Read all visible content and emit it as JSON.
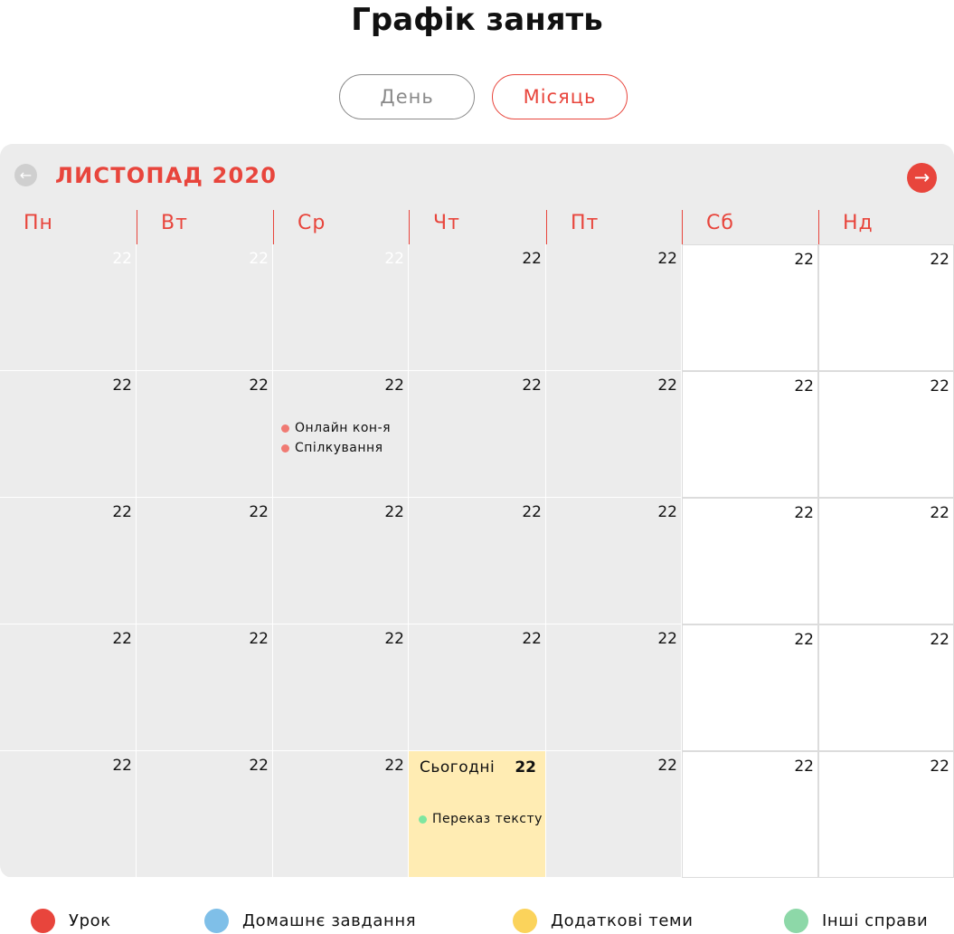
{
  "title": "Графік занять",
  "view_switch": {
    "day_label": "День",
    "month_label": "Місяць",
    "selected": "month"
  },
  "calendar": {
    "month_label": "ЛИСТОПАД 2020",
    "prev_icon": "arrow-left-icon",
    "next_icon": "arrow-right-icon",
    "weekdays": [
      "Пн",
      "Вт",
      "Ср",
      "Чт",
      "Пт",
      "Сб",
      "Нд"
    ],
    "today_label": "Сьогодні",
    "rows": [
      {
        "cells": [
          {
            "day": "22",
            "faded": true
          },
          {
            "day": "22",
            "faded": true
          },
          {
            "day": "22",
            "faded": true
          },
          {
            "day": "22"
          },
          {
            "day": "22"
          },
          {
            "day": "22"
          },
          {
            "day": "22"
          }
        ]
      },
      {
        "cells": [
          {
            "day": "22"
          },
          {
            "day": "22"
          },
          {
            "day": "22",
            "events": [
              {
                "label": "Онлайн кон-я",
                "color": "#f07a73"
              },
              {
                "label": "Спілкування",
                "color": "#f07a73"
              }
            ]
          },
          {
            "day": "22"
          },
          {
            "day": "22"
          },
          {
            "day": "22"
          },
          {
            "day": "22"
          }
        ]
      },
      {
        "cells": [
          {
            "day": "22"
          },
          {
            "day": "22"
          },
          {
            "day": "22"
          },
          {
            "day": "22"
          },
          {
            "day": "22"
          },
          {
            "day": "22"
          },
          {
            "day": "22"
          }
        ]
      },
      {
        "cells": [
          {
            "day": "22"
          },
          {
            "day": "22"
          },
          {
            "day": "22"
          },
          {
            "day": "22"
          },
          {
            "day": "22"
          },
          {
            "day": "22"
          },
          {
            "day": "22"
          }
        ]
      },
      {
        "cells": [
          {
            "day": "22"
          },
          {
            "day": "22"
          },
          {
            "day": "22"
          },
          {
            "day": "22",
            "today": true,
            "events": [
              {
                "label": "Переказ тексту",
                "color": "#7ee6a0"
              }
            ]
          },
          {
            "day": "22"
          },
          {
            "day": "22"
          },
          {
            "day": "22"
          }
        ]
      }
    ]
  },
  "legend": [
    {
      "label": "Урок",
      "color": "#e8453c"
    },
    {
      "label": "Домашнє завдання",
      "color": "#7fbfe8"
    },
    {
      "label": "Додаткові теми",
      "color": "#fbd35b"
    },
    {
      "label": "Інші справи",
      "color": "#8dd8a8"
    }
  ]
}
